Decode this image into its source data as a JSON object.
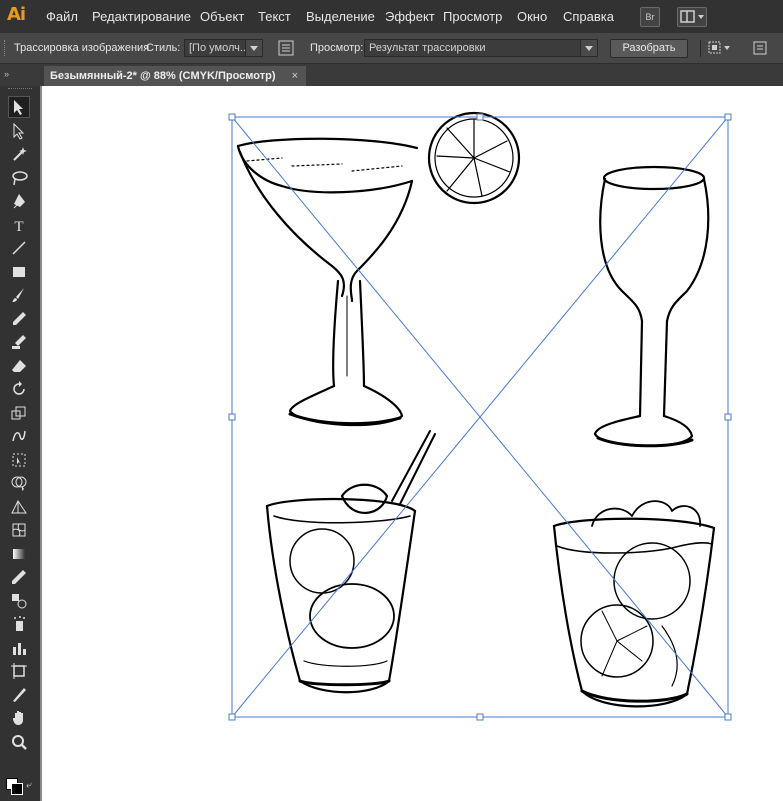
{
  "app": {
    "logo": "Ai"
  },
  "menu": {
    "items": [
      "Файл",
      "Редактирование",
      "Объект",
      "Текст",
      "Выделение",
      "Эффект",
      "Просмотр",
      "Окно",
      "Справка"
    ],
    "bridge_label": "Br"
  },
  "control": {
    "title": "Трассировка изображения",
    "style_label": "Стиль:",
    "style_value": "[По умолч...",
    "view_label": "Просмотр:",
    "view_value": "Результат трассировки",
    "expand_button": "Разобрать"
  },
  "document": {
    "tab_title": "Безымянный-2* @ 88% (CMYK/Просмотр)",
    "close": "×"
  },
  "tools": [
    "selection-icon",
    "direct-selection-icon",
    "magic-wand-icon",
    "lasso-icon",
    "pen-icon",
    "type-icon",
    "line-icon",
    "rectangle-icon",
    "paintbrush-icon",
    "pencil-icon",
    "blob-brush-icon",
    "eraser-icon",
    "rotate-icon",
    "scale-icon",
    "warp-icon",
    "free-transform-icon",
    "shape-builder-icon",
    "perspective-icon",
    "mesh-icon",
    "gradient-icon",
    "eyedropper-icon",
    "blend-icon",
    "symbol-sprayer-icon",
    "column-graph-icon",
    "artboard-icon",
    "slice-icon",
    "hand-icon",
    "zoom-icon"
  ],
  "colors": {
    "accent": "#e79b1d",
    "selection": "#4a78d0"
  }
}
